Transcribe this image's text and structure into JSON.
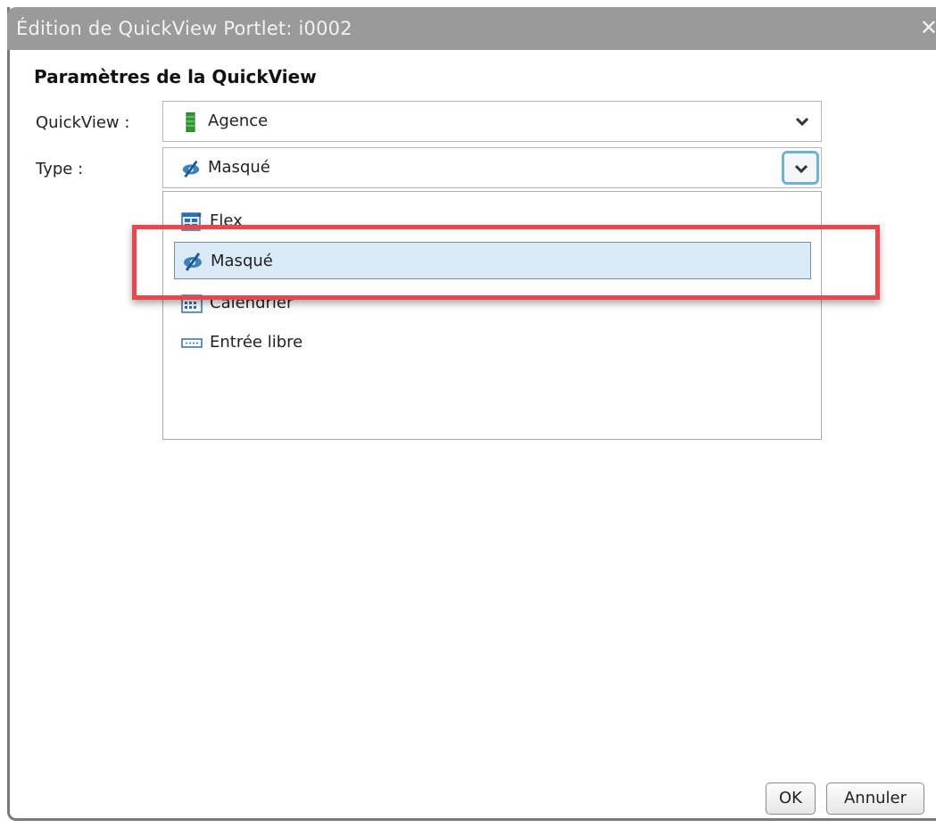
{
  "dialog": {
    "title": "Édition de QuickView Portlet: i0002",
    "close_symbol": "✕"
  },
  "section": {
    "title": "Paramètres de la QuickView"
  },
  "fields": {
    "quickview_label": "QuickView :",
    "quickview_value": "Agence",
    "quickview_icon": "green-bar-icon",
    "type_label": "Type :",
    "type_value": "Masqué",
    "type_icon": "hidden-eye-icon"
  },
  "dropdown": {
    "options": [
      {
        "label": "Flex",
        "icon": "flex-grid-icon"
      },
      {
        "label": "Masqué",
        "icon": "hidden-eye-icon",
        "selected": true
      },
      {
        "label": "Calendrier",
        "icon": "calendar-icon"
      },
      {
        "label": "Entrée libre",
        "icon": "free-input-icon"
      }
    ]
  },
  "buttons": {
    "ok": "OK",
    "cancel": "Annuler"
  },
  "colors": {
    "titlebar": "#9a9a9a",
    "highlight": "#e8484c",
    "selected_bg": "#dbeaf7",
    "focus_ring": "#6fb2d9"
  }
}
